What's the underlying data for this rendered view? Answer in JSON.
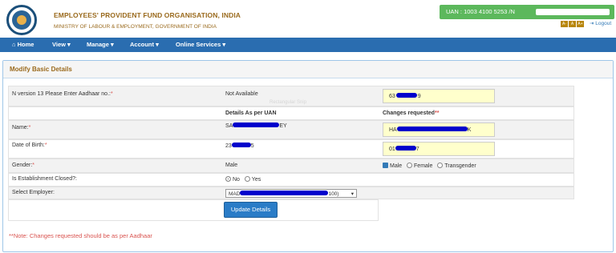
{
  "header": {
    "org_name": "EMPLOYEES' PROVIDENT FUND ORGANISATION, INDIA",
    "ministry": "MINISTRY OF LABOUR & EMPLOYMENT, GOVERNMENT OF INDIA",
    "uan_text": "UAN : 1003 4100 5253 /N",
    "font_sizes": [
      "A-",
      "A",
      "A+"
    ],
    "logout": "Logout"
  },
  "nav": {
    "home": "Home",
    "view": "View ▾",
    "manage": "Manage ▾",
    "account": "Account ▾",
    "services": "Online Services ▾"
  },
  "panel": {
    "title": "Modify Basic Details"
  },
  "form": {
    "aadhaar_label": "N version 13 Please Enter Aadhaar no.:",
    "aadhaar_value": "Not Available",
    "aadhaar_change": "63",
    "aadhaar_change_tail": "9",
    "col_uan": "Details As per UAN",
    "col_changes": "Changes requested",
    "name_label": "Name:",
    "name_value": "SA",
    "name_value_tail": "EY",
    "name_change": "HA",
    "name_change_tail": "K",
    "dob_label": "Date of Birth:",
    "dob_value": "23",
    "dob_value_tail": "5",
    "dob_change": "01",
    "dob_change_tail": "7",
    "gender_label": "Gender:",
    "gender_value": "Male",
    "gender_options": [
      "Male",
      "Female",
      "Transgender"
    ],
    "closed_label": "Is Establishment Closed?:",
    "closed_options": [
      "No",
      "Yes"
    ],
    "employer_label": "Select Employer:",
    "employer_value": "MAD",
    "employer_value_tail": "100)",
    "update_button": "Update Details",
    "note": "**Note: Changes requested should be as per Aadhaar"
  },
  "watermark": "Rectangular Snip",
  "colors": {
    "navbar": "#2a6db0",
    "uan_badge": "#5cb85c",
    "button": "#2a7cc7",
    "highlight_input": "#ffffcc",
    "note": "#d9534f"
  }
}
